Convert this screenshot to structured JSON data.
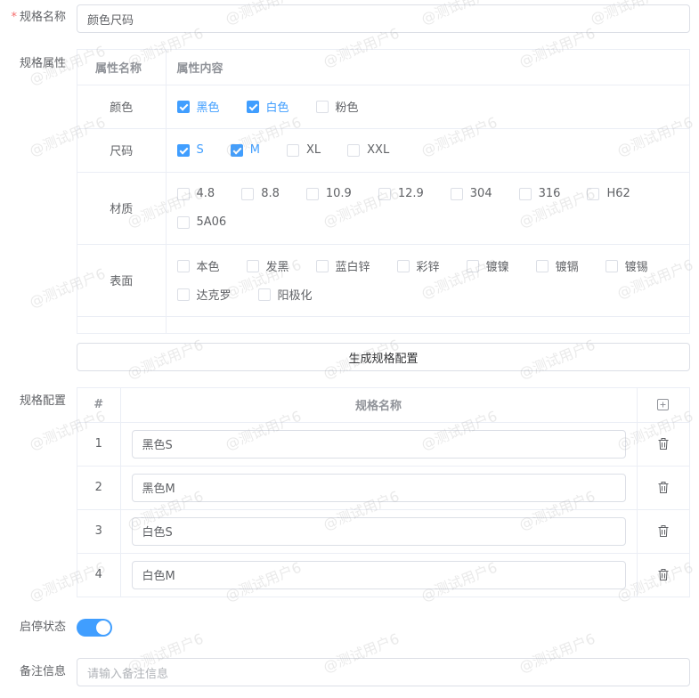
{
  "form": {
    "spec_name": {
      "label": "规格名称",
      "value": "颜色尺码"
    },
    "attrs_label": "规格属性",
    "config_label": "规格配置",
    "status_label": "启停状态",
    "remark": {
      "label": "备注信息",
      "placeholder": "请输入备注信息"
    },
    "status_on": true
  },
  "attr_table": {
    "headers": [
      "属性名称",
      "属性内容"
    ],
    "rows": [
      {
        "name": "颜色",
        "options": [
          {
            "label": "黑色",
            "checked": true
          },
          {
            "label": "白色",
            "checked": true
          },
          {
            "label": "粉色",
            "checked": false
          }
        ]
      },
      {
        "name": "尺码",
        "options": [
          {
            "label": "S",
            "checked": true
          },
          {
            "label": "M",
            "checked": true
          },
          {
            "label": "XL",
            "checked": false
          },
          {
            "label": "XXL",
            "checked": false
          }
        ]
      },
      {
        "name": "材质",
        "options": [
          {
            "label": "4.8",
            "checked": false
          },
          {
            "label": "8.8",
            "checked": false
          },
          {
            "label": "10.9",
            "checked": false
          },
          {
            "label": "12.9",
            "checked": false
          },
          {
            "label": "304",
            "checked": false
          },
          {
            "label": "316",
            "checked": false
          },
          {
            "label": "H62",
            "checked": false
          },
          {
            "label": "5A06",
            "checked": false
          }
        ]
      },
      {
        "name": "表面",
        "options": [
          {
            "label": "本色",
            "checked": false
          },
          {
            "label": "发黑",
            "checked": false
          },
          {
            "label": "蓝白锌",
            "checked": false
          },
          {
            "label": "彩锌",
            "checked": false
          },
          {
            "label": "镀镍",
            "checked": false
          },
          {
            "label": "镀镉",
            "checked": false
          },
          {
            "label": "镀锡",
            "checked": false
          },
          {
            "label": "达克罗",
            "checked": false
          },
          {
            "label": "阳极化",
            "checked": false
          }
        ]
      }
    ]
  },
  "generate_button": "生成规格配置",
  "spec_table": {
    "headers": [
      "#",
      "规格名称"
    ],
    "rows": [
      {
        "index": "1",
        "name": "黑色S"
      },
      {
        "index": "2",
        "name": "黑色M"
      },
      {
        "index": "3",
        "name": "白色S"
      },
      {
        "index": "4",
        "name": "白色M"
      }
    ]
  },
  "watermark_text": "@测试用户6",
  "colors": {
    "primary": "#409eff",
    "border": "#dcdfe6",
    "required": "#f56c6c"
  },
  "icons": {
    "add": "plus-square-icon",
    "delete": "trash-icon"
  }
}
